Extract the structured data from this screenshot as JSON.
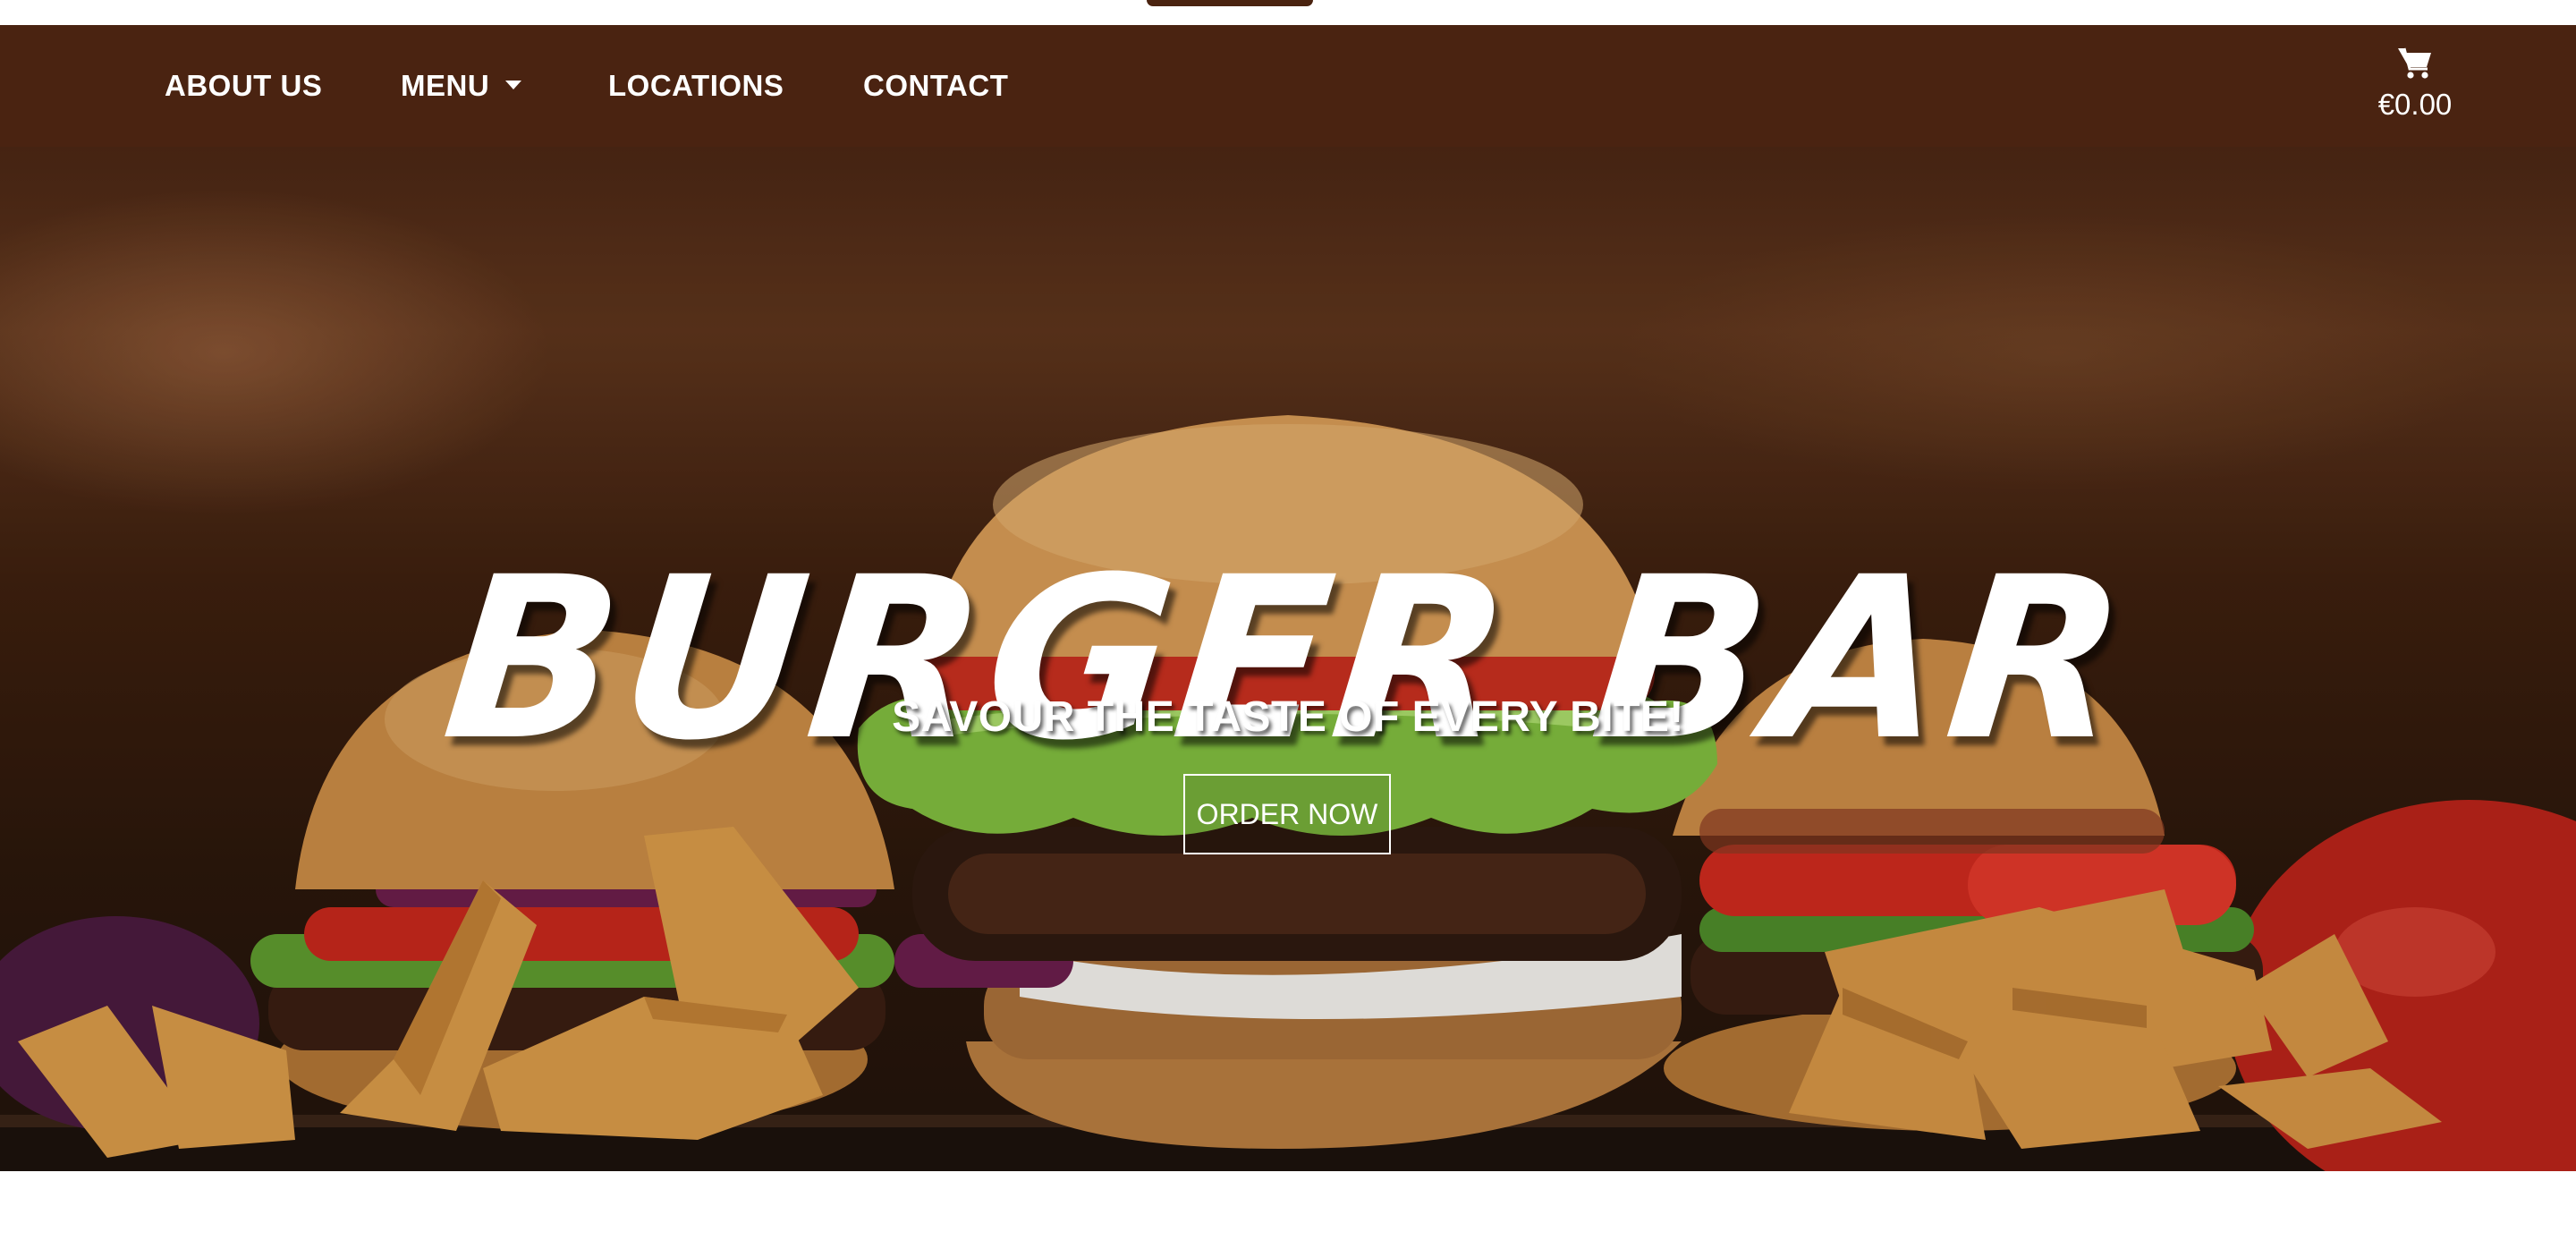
{
  "nav": {
    "items": [
      {
        "label": "ABOUT US"
      },
      {
        "label": "MENU"
      },
      {
        "label": "LOCATIONS"
      },
      {
        "label": "CONTACT"
      }
    ]
  },
  "cart": {
    "icon": "cart-icon",
    "total": "€0.00"
  },
  "hero": {
    "title": "BURGER BAR",
    "subtitle": "SAVOUR THE TASTE OF EVERY BITE!",
    "cta_label": "ORDER NOW"
  },
  "colors": {
    "navbar": "#4a2311",
    "text": "#ffffff",
    "background": "#ffffff"
  }
}
